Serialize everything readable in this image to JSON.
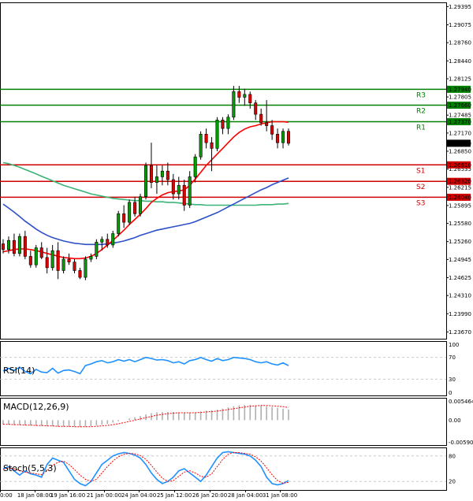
{
  "chart_data": {
    "type": "candlestick",
    "colors": {
      "up": "#00a000",
      "down": "#e00000",
      "ma_fast": "#ff0000",
      "ma_mid": "#2d50c8",
      "ma_slow": "#3cb378",
      "rsi": "#1e90ff",
      "macd_hist": "#b0b0b0",
      "macd_signal": "#ff0000",
      "stoch_k": "#1e90ff",
      "stoch_d": "#ff0000",
      "resistance": "#008000",
      "support": "#d00000",
      "last_price_box": "#000000"
    },
    "price_axis": {
      "ylim": [
        1.2355,
        1.2947
      ],
      "ticks": [
        "1.29395",
        "1.29075",
        "1.28760",
        "1.28440",
        "1.28125",
        "1.27805",
        "1.27485",
        "1.27170",
        "1.26850",
        "1.26535",
        "1.26215",
        "1.25895",
        "1.25580",
        "1.25260",
        "1.24945",
        "1.24625",
        "1.24310",
        "1.23990",
        "1.23670"
      ]
    },
    "x_labels": [
      "0:00",
      "18 Jan 08:00",
      "19 Jan 16:00",
      "21 Jan 00:00",
      "24 Jan 04:00",
      "25 Jan 12:00",
      "26 Jan 20:00",
      "28 Jan 04:00",
      "31 Jan 08:00"
    ],
    "last_price": "1.26990",
    "levels": [
      {
        "name": "R3",
        "value": 1.2794,
        "label": "1.27940",
        "kind": "resistance"
      },
      {
        "name": "R2",
        "value": 1.2766,
        "label": "1.27660",
        "kind": "resistance"
      },
      {
        "name": "R1",
        "value": 1.2737,
        "label": "1.27370",
        "kind": "resistance"
      },
      {
        "name": "S1",
        "value": 1.2661,
        "label": "1.26610",
        "kind": "support"
      },
      {
        "name": "S2",
        "value": 1.2632,
        "label": "1.26320",
        "kind": "support"
      },
      {
        "name": "S3",
        "value": 1.2604,
        "label": "1.26040",
        "kind": "support"
      }
    ],
    "candles": [
      [
        1.2522,
        1.253,
        1.2505,
        1.2512
      ],
      [
        1.2512,
        1.2535,
        1.2505,
        1.2528
      ],
      [
        1.2528,
        1.254,
        1.25,
        1.2505
      ],
      [
        1.2505,
        1.254,
        1.25,
        1.2535
      ],
      [
        1.2535,
        1.2545,
        1.2495,
        1.25
      ],
      [
        1.25,
        1.251,
        1.248,
        1.2485
      ],
      [
        1.2485,
        1.252,
        1.248,
        1.2515
      ],
      [
        1.2515,
        1.2525,
        1.2495,
        1.2498
      ],
      [
        1.2498,
        1.2515,
        1.247,
        1.248
      ],
      [
        1.248,
        1.252,
        1.2475,
        1.251
      ],
      [
        1.251,
        1.2525,
        1.246,
        1.2475
      ],
      [
        1.2475,
        1.25,
        1.247,
        1.2495
      ],
      [
        1.2495,
        1.2505,
        1.2485,
        1.249
      ],
      [
        1.249,
        1.2495,
        1.247,
        1.2475
      ],
      [
        1.2475,
        1.248,
        1.246,
        1.2463
      ],
      [
        1.2463,
        1.25,
        1.2458,
        1.2495
      ],
      [
        1.2495,
        1.2505,
        1.249,
        1.25
      ],
      [
        1.25,
        1.253,
        1.2495,
        1.2525
      ],
      [
        1.2525,
        1.2535,
        1.251,
        1.253
      ],
      [
        1.253,
        1.254,
        1.2515,
        1.252
      ],
      [
        1.252,
        1.2545,
        1.2515,
        1.254
      ],
      [
        1.254,
        1.258,
        1.2535,
        1.2575
      ],
      [
        1.2575,
        1.259,
        1.255,
        1.256
      ],
      [
        1.256,
        1.26,
        1.2555,
        1.2595
      ],
      [
        1.2595,
        1.2605,
        1.257,
        1.2575
      ],
      [
        1.2575,
        1.261,
        1.257,
        1.2605
      ],
      [
        1.2605,
        1.2665,
        1.26,
        1.266
      ],
      [
        1.266,
        1.27,
        1.262,
        1.263
      ],
      [
        1.263,
        1.266,
        1.261,
        1.264
      ],
      [
        1.264,
        1.266,
        1.2625,
        1.265
      ],
      [
        1.265,
        1.2665,
        1.2625,
        1.2635
      ],
      [
        1.2635,
        1.2645,
        1.26,
        1.261
      ],
      [
        1.261,
        1.264,
        1.26,
        1.2625
      ],
      [
        1.2625,
        1.2635,
        1.258,
        1.259
      ],
      [
        1.259,
        1.265,
        1.2585,
        1.264
      ],
      [
        1.264,
        1.268,
        1.263,
        1.2675
      ],
      [
        1.2675,
        1.272,
        1.267,
        1.2715
      ],
      [
        1.2715,
        1.2725,
        1.269,
        1.27
      ],
      [
        1.27,
        1.271,
        1.265,
        1.269
      ],
      [
        1.269,
        1.2745,
        1.2685,
        1.274
      ],
      [
        1.274,
        1.2745,
        1.2715,
        1.2725
      ],
      [
        1.2725,
        1.275,
        1.2715,
        1.2745
      ],
      [
        1.2745,
        1.28,
        1.274,
        1.279
      ],
      [
        1.279,
        1.28,
        1.277,
        1.278
      ],
      [
        1.278,
        1.2795,
        1.2765,
        1.2785
      ],
      [
        1.2785,
        1.279,
        1.276,
        1.277
      ],
      [
        1.277,
        1.2775,
        1.274,
        1.275
      ],
      [
        1.275,
        1.276,
        1.273,
        1.2735
      ],
      [
        1.2735,
        1.2775,
        1.272,
        1.273
      ],
      [
        1.273,
        1.274,
        1.2705,
        1.2715
      ],
      [
        1.2715,
        1.2725,
        1.269,
        1.27
      ],
      [
        1.27,
        1.2725,
        1.269,
        1.272
      ],
      [
        1.272,
        1.2725,
        1.2695,
        1.2699
      ]
    ],
    "ma_fast": [
      1.2508,
      1.251,
      1.2512,
      1.2513,
      1.2513,
      1.2512,
      1.251,
      1.2508,
      1.2505,
      1.2503,
      1.25,
      1.2498,
      1.2497,
      1.2496,
      1.2496,
      1.2497,
      1.25,
      1.2505,
      1.2512,
      1.252,
      1.2528,
      1.2537,
      1.2546,
      1.2556,
      1.2565,
      1.2574,
      1.2584,
      1.2595,
      1.2602,
      1.2608,
      1.2612,
      1.2614,
      1.2615,
      1.2617,
      1.2625,
      1.2636,
      1.2648,
      1.266,
      1.267,
      1.268,
      1.269,
      1.27,
      1.271,
      1.2718,
      1.2724,
      1.2728,
      1.273,
      1.2733,
      1.2735,
      1.2737,
      1.2737,
      1.2737,
      1.2736
    ],
    "ma_mid": [
      1.2592,
      1.2585,
      1.2578,
      1.257,
      1.2562,
      1.2555,
      1.2548,
      1.2542,
      1.2537,
      1.2533,
      1.253,
      1.2527,
      1.2525,
      1.2523,
      1.2522,
      1.2521,
      1.2521,
      1.2521,
      1.2521,
      1.2522,
      1.2523,
      1.2525,
      1.2527,
      1.253,
      1.2533,
      1.2537,
      1.254,
      1.2543,
      1.2546,
      1.2548,
      1.255,
      1.2552,
      1.2554,
      1.2556,
      1.2558,
      1.2561,
      1.2565,
      1.2569,
      1.2573,
      1.2577,
      1.2582,
      1.2587,
      1.2592,
      1.2597,
      1.2602,
      1.2607,
      1.2612,
      1.2617,
      1.2621,
      1.2626,
      1.263,
      1.2634,
      1.2638
    ],
    "ma_slow": [
      1.2665,
      1.2663,
      1.266,
      1.2657,
      1.2653,
      1.2649,
      1.2645,
      1.2641,
      1.2637,
      1.2633,
      1.2629,
      1.2625,
      1.2622,
      1.2619,
      1.2616,
      1.2613,
      1.261,
      1.2608,
      1.2606,
      1.2604,
      1.2602,
      1.2601,
      1.26,
      1.2599,
      1.2598,
      1.2598,
      1.2597,
      1.2597,
      1.2596,
      1.2596,
      1.2595,
      1.2595,
      1.2594,
      1.2593,
      1.2592,
      1.2591,
      1.2591,
      1.259,
      1.259,
      1.259,
      1.259,
      1.259,
      1.259,
      1.259,
      1.259,
      1.259,
      1.259,
      1.2591,
      1.2591,
      1.2591,
      1.2592,
      1.2592,
      1.2593
    ],
    "rsi": {
      "label": "RSI(14)",
      "ylim": [
        0,
        100
      ],
      "ticks": [
        "100",
        "70",
        "30",
        "0"
      ],
      "values": [
        45,
        50,
        46,
        52,
        44,
        40,
        48,
        43,
        42,
        50,
        41,
        46,
        47,
        44,
        40,
        55,
        58,
        62,
        64,
        60,
        62,
        66,
        63,
        66,
        62,
        66,
        70,
        68,
        65,
        66,
        64,
        60,
        62,
        58,
        64,
        66,
        70,
        66,
        63,
        68,
        64,
        66,
        70,
        69,
        68,
        66,
        62,
        60,
        62,
        58,
        56,
        60,
        55
      ]
    },
    "macd": {
      "label": "MACD(12,26,9)",
      "ylim": [
        -0.00609,
        0.00546
      ],
      "ticks": [
        "0.005464",
        "0.00",
        "-0.005908"
      ],
      "hist": [
        -0.0011,
        -0.0011,
        -0.0012,
        -0.0012,
        -0.0013,
        -0.0013,
        -0.0014,
        -0.0014,
        -0.0015,
        -0.0015,
        -0.0016,
        -0.0016,
        -0.0016,
        -0.0016,
        -0.0017,
        -0.0016,
        -0.0015,
        -0.0013,
        -0.0011,
        -0.0009,
        -0.0006,
        -0.0003,
        0.0,
        0.0004,
        0.0007,
        0.001,
        0.0014,
        0.0017,
        0.0019,
        0.002,
        0.002,
        0.002,
        0.0019,
        0.0018,
        0.0018,
        0.0019,
        0.0021,
        0.0023,
        0.0024,
        0.0026,
        0.0028,
        0.0031,
        0.0034,
        0.0036,
        0.0037,
        0.0037,
        0.0036,
        0.0035,
        0.0034,
        0.0032,
        0.003,
        0.0028,
        0.0026
      ],
      "signal": [
        -0.001,
        -0.001,
        -0.0011,
        -0.0011,
        -0.0012,
        -0.0012,
        -0.0013,
        -0.0013,
        -0.0014,
        -0.0014,
        -0.0015,
        -0.0015,
        -0.0015,
        -0.0016,
        -0.0016,
        -0.0016,
        -0.0016,
        -0.0015,
        -0.0014,
        -0.0013,
        -0.0011,
        -0.0009,
        -0.0006,
        -0.0003,
        0.0,
        0.0003,
        0.0006,
        0.0009,
        0.0012,
        0.0014,
        0.0016,
        0.0017,
        0.0018,
        0.0018,
        0.0018,
        0.0018,
        0.0019,
        0.002,
        0.0021,
        0.0022,
        0.0024,
        0.0026,
        0.0028,
        0.003,
        0.0032,
        0.0034,
        0.0035,
        0.0036,
        0.0036,
        0.0035,
        0.0034,
        0.0033,
        0.0031
      ]
    },
    "stoch": {
      "label": "Stoch(5,5,3)",
      "ylim": [
        0,
        100
      ],
      "ticks": [
        "80",
        "20"
      ],
      "k": [
        50,
        55,
        45,
        35,
        45,
        38,
        35,
        30,
        60,
        75,
        70,
        65,
        45,
        25,
        15,
        10,
        20,
        40,
        60,
        70,
        80,
        85,
        88,
        86,
        82,
        75,
        60,
        40,
        25,
        15,
        20,
        30,
        45,
        50,
        40,
        30,
        20,
        35,
        55,
        75,
        88,
        90,
        88,
        86,
        84,
        80,
        70,
        55,
        30,
        15,
        12,
        15,
        22
      ],
      "d": [
        48,
        52,
        50,
        45,
        42,
        40,
        38,
        36,
        45,
        58,
        65,
        68,
        60,
        48,
        35,
        25,
        20,
        25,
        40,
        55,
        68,
        78,
        84,
        86,
        85,
        81,
        72,
        58,
        42,
        28,
        20,
        22,
        32,
        42,
        45,
        40,
        32,
        30,
        38,
        55,
        72,
        84,
        88,
        88,
        86,
        84,
        78,
        68,
        52,
        36,
        22,
        16,
        18
      ]
    }
  }
}
